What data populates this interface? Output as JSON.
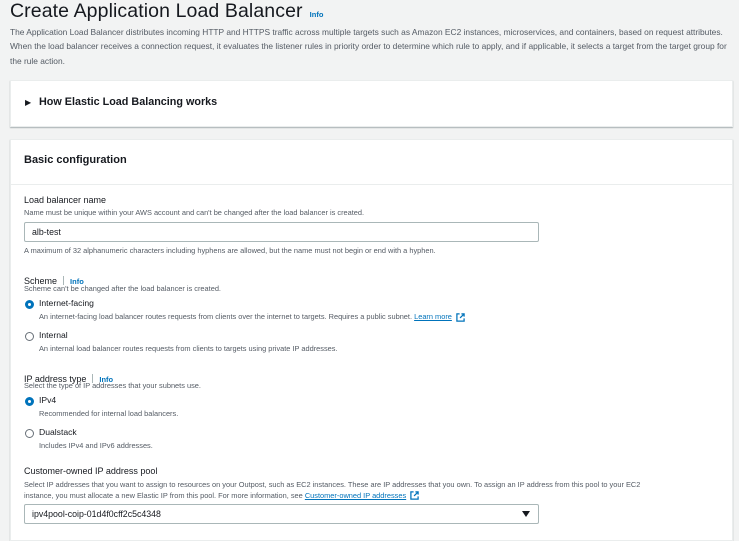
{
  "header": {
    "title": "Create Application Load Balancer",
    "info": "Info",
    "description": "The Application Load Balancer distributes incoming HTTP and HTTPS traffic across multiple targets such as Amazon EC2 instances, microservices, and containers, based on request attributes. When the load balancer receives a connection request, it evaluates the listener rules in priority order to determine which rule to apply, and if applicable, it selects a target from the target group for the rule action."
  },
  "how_it_works": {
    "label": "How Elastic Load Balancing works"
  },
  "basic": {
    "title": "Basic configuration",
    "name": {
      "label": "Load balancer name",
      "description": "Name must be unique within your AWS account and can't be changed after the load balancer is created.",
      "value": "alb-test",
      "constraint": "A maximum of 32 alphanumeric characters including hyphens are allowed, but the name must not begin or end with a hyphen."
    },
    "scheme": {
      "label": "Scheme",
      "info": "Info",
      "description": "Scheme can't be changed after the load balancer is created.",
      "options": [
        {
          "label": "Internet-facing",
          "description": "An internet-facing load balancer routes requests from clients over the internet to targets. Requires a public subnet.",
          "link": "Learn more",
          "selected": true
        },
        {
          "label": "Internal",
          "description": "An internal load balancer routes requests from clients to targets using private IP addresses.",
          "selected": false
        }
      ]
    },
    "ip_type": {
      "label": "IP address type",
      "info": "Info",
      "description": "Select the type of IP addresses that your subnets use.",
      "options": [
        {
          "label": "IPv4",
          "description": "Recommended for internal load balancers.",
          "selected": true
        },
        {
          "label": "Dualstack",
          "description": "Includes IPv4 and IPv6 addresses.",
          "selected": false
        }
      ]
    },
    "coip": {
      "label": "Customer-owned IP address pool",
      "description_1": "Select IP addresses that you want to assign to resources on your Outpost, such as EC2 instances. These are IP addresses that you own. To assign an IP address from this pool to your EC2",
      "description_2": "instance, you must allocate a new Elastic IP from this pool. For more information, see",
      "link": "Customer-owned IP addresses",
      "value": "ipv4pool-coip-01d4f0cff2c5c4348"
    }
  },
  "colors": {
    "link": "#0073bb",
    "text": "#16191f",
    "muted": "#545b64",
    "background": "#f2f3f3"
  }
}
